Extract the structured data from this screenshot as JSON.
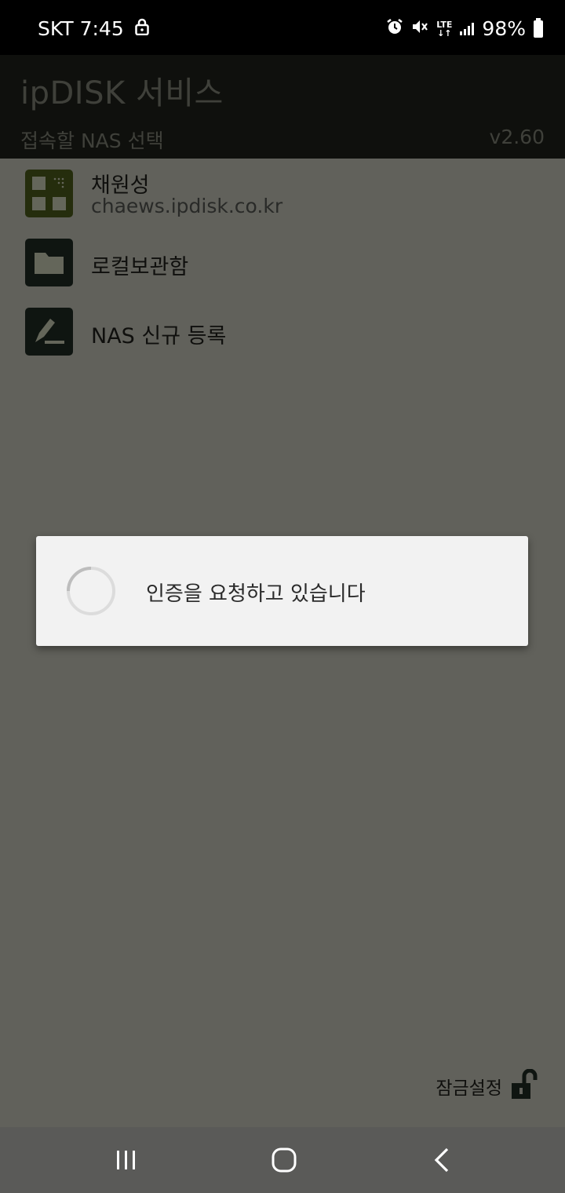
{
  "status_bar": {
    "carrier": "SKT",
    "time": "7:45",
    "network": "LTE",
    "battery": "98%",
    "icons": [
      "lock-icon",
      "alarm-icon",
      "mute-icon",
      "signal-icon",
      "battery-icon"
    ]
  },
  "header": {
    "title": "ipDISK 서비스",
    "subtitle": "접속할 NAS 선택",
    "version": "v2.60"
  },
  "nas_list": [
    {
      "name": "채원성",
      "host": "chaews.ipdisk.co.kr",
      "icon": "nas-grid-icon"
    },
    {
      "name": "로컬보관함",
      "host": "",
      "icon": "folder-icon"
    },
    {
      "name": "NAS 신규 등록",
      "host": "",
      "icon": "edit-pen-icon"
    }
  ],
  "footer": {
    "lock_label": "잠금설정",
    "lock_icon": "unlock-icon"
  },
  "dialog": {
    "message": "인증을 요청하고 있습니다"
  },
  "nav_bar": {
    "buttons": [
      "recent-apps",
      "home",
      "back"
    ]
  },
  "colors": {
    "header_bg": "#1f211b",
    "content_bg": "#c2c2b6",
    "icon_green": "#4a5a1a",
    "icon_dark": "#1f2a22",
    "dialog_bg": "#f2f2f2"
  }
}
